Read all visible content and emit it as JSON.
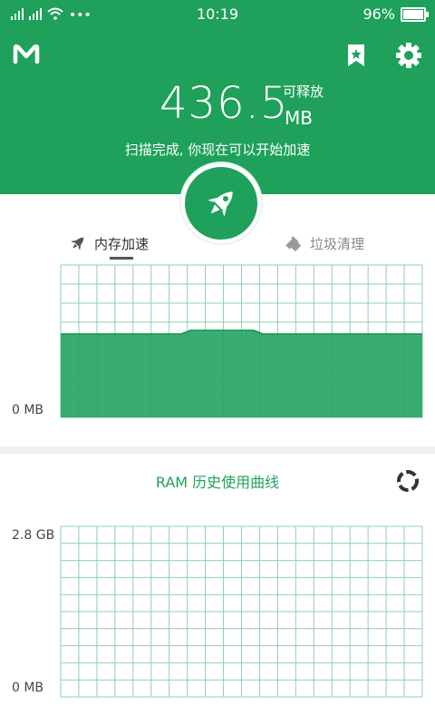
{
  "status_bar": {
    "time": "10:19",
    "battery_text": "96%",
    "battery_level": 0.96
  },
  "header": {
    "freeable_value": "436.5",
    "freeable_label": "可释放",
    "freeable_unit": "MB",
    "message": "扫描完成, 你现在可以开始加速",
    "icons": [
      "app-logo-icon",
      "bookmark-icon",
      "settings-icon",
      "rocket-icon"
    ]
  },
  "tabs": [
    {
      "label": "内存加速",
      "icon": "rocket-icon",
      "active": true
    },
    {
      "label": "垃圾清理",
      "icon": "broom-icon",
      "active": false
    }
  ],
  "memory_chart": {
    "y_bottom_label": "0 MB",
    "fill_color": "#27a565"
  },
  "history_chart": {
    "title": "RAM 历史使用曲线",
    "y_top_label": "2.8 GB",
    "y_bottom_label": "0 MB",
    "refresh_icon": "refresh-icon"
  },
  "colors": {
    "brand": "#1fa15b",
    "grid": "#8fd0ae"
  }
}
